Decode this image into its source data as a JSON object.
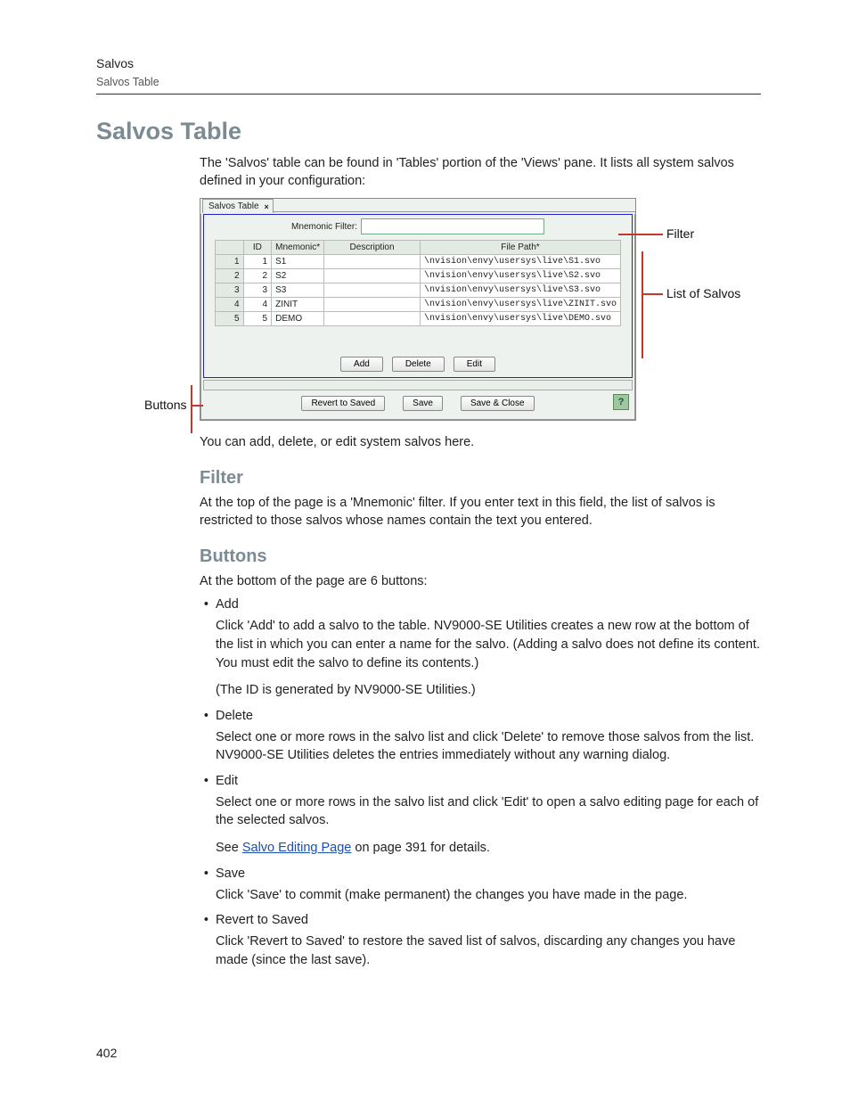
{
  "header": {
    "title": "Salvos",
    "subtitle": "Salvos Table"
  },
  "h1": "Salvos Table",
  "intro": "The 'Salvos' table can be found in 'Tables' portion of the 'Views' pane. It lists all system salvos defined in your configuration:",
  "screenshot": {
    "tab_label": "Salvos Table",
    "filter_label": "Mnemonic Filter:",
    "filter_value": "",
    "columns": {
      "c0": "",
      "c1": "ID",
      "c2": "Mnemonic*",
      "c3": "Description",
      "c4": "File Path*"
    },
    "rows": [
      {
        "n": "1",
        "id": "1",
        "mn": "S1",
        "desc": "",
        "path": "\\nvision\\envy\\usersys\\live\\S1.svo"
      },
      {
        "n": "2",
        "id": "2",
        "mn": "S2",
        "desc": "",
        "path": "\\nvision\\envy\\usersys\\live\\S2.svo"
      },
      {
        "n": "3",
        "id": "3",
        "mn": "S3",
        "desc": "",
        "path": "\\nvision\\envy\\usersys\\live\\S3.svo"
      },
      {
        "n": "4",
        "id": "4",
        "mn": "ZINIT",
        "desc": "",
        "path": "\\nvision\\envy\\usersys\\live\\ZINIT.svo"
      },
      {
        "n": "5",
        "id": "5",
        "mn": "DEMO",
        "desc": "",
        "path": "\\nvision\\envy\\usersys\\live\\DEMO.svo"
      }
    ],
    "buttons": {
      "add": "Add",
      "delete": "Delete",
      "edit": "Edit",
      "revert": "Revert to Saved",
      "save": "Save",
      "save_close": "Save & Close"
    },
    "help": "?"
  },
  "callouts": {
    "filter": "Filter",
    "list": "List of Salvos",
    "buttons": "Buttons"
  },
  "after_shot": "You can add, delete, or edit system salvos here.",
  "filter_h": "Filter",
  "filter_p": "At the top of the page is a 'Mnemonic' filter. If you enter text in this field, the list of salvos is restricted to those salvos whose names contain the text you entered.",
  "buttons_h": "Buttons",
  "buttons_intro": "At the bottom of the page are 6 buttons:",
  "bul": {
    "add_t": "Add",
    "add_p1": "Click 'Add' to add a salvo to the table. NV9000-SE Utilities creates a new row at the bottom of the list in which you can enter a name for the salvo. (Adding a salvo does not define its content. You must edit the salvo to define its contents.)",
    "add_p2": "(The ID is generated by NV9000-SE Utilities.)",
    "del_t": "Delete",
    "del_p": "Select one or more rows in the salvo list and click 'Delete' to remove those salvos from the list. NV9000-SE Utilities deletes the entries immediately without any warning dialog.",
    "edit_t": "Edit",
    "edit_p1": "Select one or more rows in the salvo list and click 'Edit' to open a salvo editing page for each of the selected salvos.",
    "edit_see1": "See ",
    "edit_link": "Salvo Editing Page",
    "edit_see2": " on page 391 for details.",
    "save_t": "Save",
    "save_p": "Click 'Save' to commit (make permanent) the changes you have made in the page.",
    "rev_t": "Revert to Saved",
    "rev_p": "Click 'Revert to Saved' to restore the saved list of salvos, discarding any changes you have made (since the last save)."
  },
  "page_number": "402"
}
